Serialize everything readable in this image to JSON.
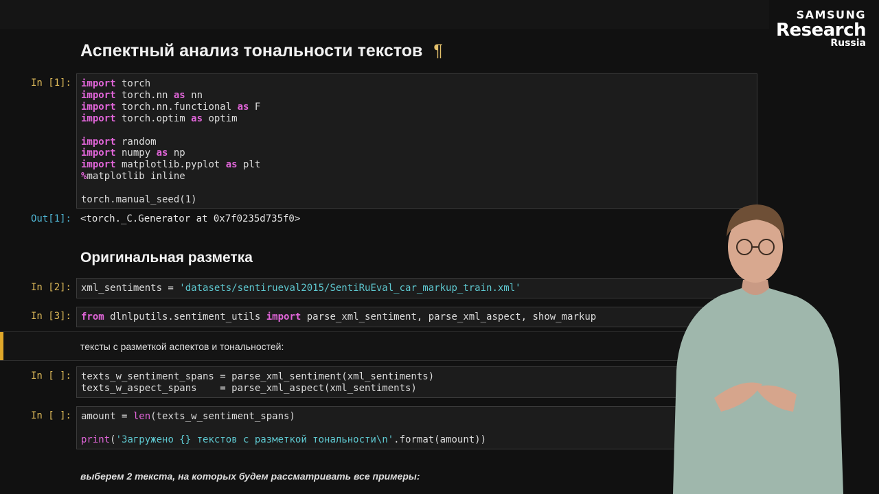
{
  "logo": {
    "line1": "SAMSUNG",
    "line2": "Research",
    "line3": "Russia"
  },
  "headings": {
    "main": "Аспектный анализ тональности текстов",
    "main_anchor": "¶",
    "section": "Оригинальная разметка"
  },
  "cells": {
    "c1": {
      "prompt": "In [1]:",
      "lines": [
        [
          {
            "t": "import",
            "c": "kw"
          },
          {
            "t": " torch"
          }
        ],
        [
          {
            "t": "import",
            "c": "kw"
          },
          {
            "t": " torch.nn "
          },
          {
            "t": "as",
            "c": "kw"
          },
          {
            "t": " nn"
          }
        ],
        [
          {
            "t": "import",
            "c": "kw"
          },
          {
            "t": " torch.nn.functional "
          },
          {
            "t": "as",
            "c": "kw"
          },
          {
            "t": " F"
          }
        ],
        [
          {
            "t": "import",
            "c": "kw"
          },
          {
            "t": " torch.optim "
          },
          {
            "t": "as",
            "c": "kw"
          },
          {
            "t": " optim"
          }
        ],
        [],
        [
          {
            "t": "import",
            "c": "kw"
          },
          {
            "t": " random"
          }
        ],
        [
          {
            "t": "import",
            "c": "kw"
          },
          {
            "t": " numpy "
          },
          {
            "t": "as",
            "c": "kw"
          },
          {
            "t": " np"
          }
        ],
        [
          {
            "t": "import",
            "c": "kw"
          },
          {
            "t": " matplotlib.pyplot "
          },
          {
            "t": "as",
            "c": "kw"
          },
          {
            "t": " plt"
          }
        ],
        [
          {
            "t": "%",
            "c": "magic"
          },
          {
            "t": "matplotlib inline"
          }
        ],
        [],
        [
          {
            "t": "torch.manual_seed(1)"
          }
        ]
      ],
      "out_prompt": "Out[1]:",
      "output": "<torch._C.Generator at 0x7f0235d735f0>"
    },
    "c2": {
      "prompt": "In [2]:",
      "lines": [
        [
          {
            "t": "xml_sentiments = "
          },
          {
            "t": "'datasets/sentirueval2015/SentiRuEval_car_markup_train.xml'",
            "c": "str"
          }
        ]
      ]
    },
    "c3": {
      "prompt": "In [3]:",
      "lines": [
        [
          {
            "t": "from",
            "c": "kw"
          },
          {
            "t": " dlnlputils.sentiment_utils "
          },
          {
            "t": "import",
            "c": "kw"
          },
          {
            "t": " parse_xml_sentiment, parse_xml_aspect, show_markup"
          }
        ]
      ]
    },
    "md1": {
      "text": "тексты с разметкой аспектов и тональностей:"
    },
    "c4": {
      "prompt": "In [ ]:",
      "lines": [
        [
          {
            "t": "texts_w_sentiment_spans = parse_xml_sentiment(xml_sentiments)"
          }
        ],
        [
          {
            "t": "texts_w_aspect_spans    = parse_xml_aspect(xml_sentiments)"
          }
        ]
      ]
    },
    "c5": {
      "prompt": "In [ ]:",
      "lines": [
        [
          {
            "t": "amount = "
          },
          {
            "t": "len",
            "c": "bi"
          },
          {
            "t": "(texts_w_sentiment_spans)"
          }
        ],
        [],
        [
          {
            "t": "print",
            "c": "bi"
          },
          {
            "t": "("
          },
          {
            "t": "'Загружено {} текстов с разметкой тональности\\n'",
            "c": "str"
          },
          {
            "t": ".format(amount))"
          }
        ]
      ]
    },
    "md2": {
      "text": "выберем 2 текста, на которых будем рассматривать все примеры:"
    }
  },
  "colors": {
    "keyword": "#e065d8",
    "string": "#5ec8d0",
    "in_prompt": "#e0bc5a",
    "out_prompt": "#4fb6d4",
    "md_bar": "#e0a82a"
  }
}
